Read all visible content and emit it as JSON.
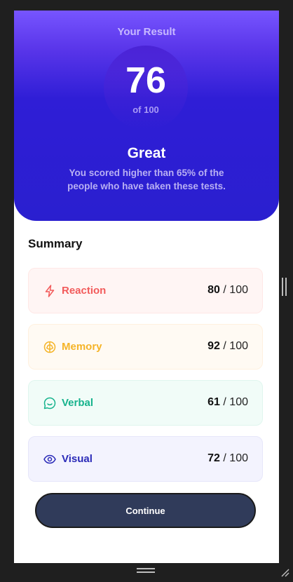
{
  "result": {
    "heading": "Your Result",
    "score": "76",
    "score_max": "of 100",
    "title": "Great",
    "description": "You scored higher than 65% of the people who have taken these tests."
  },
  "summary": {
    "title": "Summary",
    "items": [
      {
        "label": "Reaction",
        "score": "80",
        "max": "100",
        "icon": "lightning-icon",
        "color": "#f25b5b"
      },
      {
        "label": "Memory",
        "score": "92",
        "max": "100",
        "icon": "brain-icon",
        "color": "#f5b428"
      },
      {
        "label": "Verbal",
        "score": "61",
        "max": "100",
        "icon": "chat-bubble-icon",
        "color": "#17b38d"
      },
      {
        "label": "Visual",
        "score": "72",
        "max": "100",
        "icon": "eye-icon",
        "color": "#2a2ab8"
      }
    ]
  },
  "continue_label": "Continue",
  "colors": {
    "gradient_top": "#7755ff",
    "gradient_bottom": "#2a1fcf",
    "button": "#303b5a",
    "background": "#1f1f1f"
  }
}
